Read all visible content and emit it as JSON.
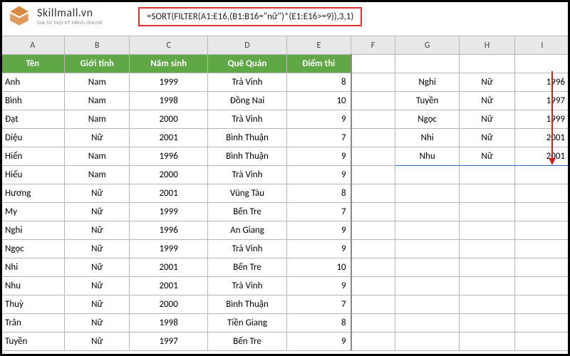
{
  "logo": {
    "main": "Skillmall.vn",
    "sub": "GIA SƯ MỌI KỸ NĂNG ONLINE"
  },
  "formula": "=SORT(FILTER(A1:E16,(B1:B16=\"nữ\")*(E1:E16>=9)),3,1)",
  "colHeads": [
    "A",
    "B",
    "C",
    "D",
    "E",
    "F",
    "G",
    "H",
    "I"
  ],
  "headers": {
    "ten": "Tên",
    "gioitinh": "Giới tính",
    "namsinh": "Năm sinh",
    "quequan": "Quê Quán",
    "diemthi": "Điểm thi"
  },
  "rows": [
    {
      "ten": "Anh",
      "gt": "Nam",
      "ns": "1999",
      "qq": "Trà Vinh",
      "dt": "8"
    },
    {
      "ten": "Bình",
      "gt": "Nam",
      "ns": "1998",
      "qq": "Đồng Nai",
      "dt": "10"
    },
    {
      "ten": "Đạt",
      "gt": "Nam",
      "ns": "2000",
      "qq": "Trà Vinh",
      "dt": "9"
    },
    {
      "ten": "Diệu",
      "gt": "Nữ",
      "ns": "2001",
      "qq": "Bình Thuận",
      "dt": "7"
    },
    {
      "ten": "Hiển",
      "gt": "Nam",
      "ns": "1996",
      "qq": "Bình Thuận",
      "dt": "9"
    },
    {
      "ten": "Hiếu",
      "gt": "Nam",
      "ns": "2000",
      "qq": "Trà Vinh",
      "dt": "9"
    },
    {
      "ten": "Hương",
      "gt": "Nữ",
      "ns": "2001",
      "qq": "Vũng Tàu",
      "dt": "8"
    },
    {
      "ten": "My",
      "gt": "Nữ",
      "ns": "1999",
      "qq": "Bến Tre",
      "dt": "7"
    },
    {
      "ten": "Nghi",
      "gt": "Nữ",
      "ns": "1996",
      "qq": "An Giang",
      "dt": "9"
    },
    {
      "ten": "Ngọc",
      "gt": "Nữ",
      "ns": "1999",
      "qq": "Trà Vinh",
      "dt": "9"
    },
    {
      "ten": "Nhi",
      "gt": "Nữ",
      "ns": "2001",
      "qq": "Bến Tre",
      "dt": "10"
    },
    {
      "ten": "Nhu",
      "gt": "Nữ",
      "ns": "2001",
      "qq": "Trà Vinh",
      "dt": "9"
    },
    {
      "ten": "Thuỳ",
      "gt": "Nữ",
      "ns": "2000",
      "qq": "Bình Thuận",
      "dt": "7"
    },
    {
      "ten": "Trân",
      "gt": "Nữ",
      "ns": "1998",
      "qq": "Tiền Giang",
      "dt": "8"
    },
    {
      "ten": "Tuyền",
      "gt": "Nữ",
      "ns": "1997",
      "qq": "Bến Tre",
      "dt": "9"
    }
  ],
  "result": [
    {
      "g": "Nghi",
      "h": "Nữ",
      "i": "1996"
    },
    {
      "g": "Tuyền",
      "h": "Nữ",
      "i": "1997"
    },
    {
      "g": "Ngọc",
      "h": "Nữ",
      "i": "1999"
    },
    {
      "g": "Nhi",
      "h": "Nữ",
      "i": "2001"
    },
    {
      "g": "Nhu",
      "h": "Nữ",
      "i": "2001"
    }
  ],
  "chart_data": {
    "type": "table",
    "title": "Student table with SORT+FILTER formula result",
    "source_columns": [
      "Tên",
      "Giới tính",
      "Năm sinh",
      "Quê Quán",
      "Điểm thi"
    ],
    "source_rows": [
      [
        "Anh",
        "Nam",
        1999,
        "Trà Vinh",
        8
      ],
      [
        "Bình",
        "Nam",
        1998,
        "Đồng Nai",
        10
      ],
      [
        "Đạt",
        "Nam",
        2000,
        "Trà Vinh",
        9
      ],
      [
        "Diệu",
        "Nữ",
        2001,
        "Bình Thuận",
        7
      ],
      [
        "Hiển",
        "Nam",
        1996,
        "Bình Thuận",
        9
      ],
      [
        "Hiếu",
        "Nam",
        2000,
        "Trà Vinh",
        9
      ],
      [
        "Hương",
        "Nữ",
        2001,
        "Vũng Tàu",
        8
      ],
      [
        "My",
        "Nữ",
        1999,
        "Bến Tre",
        7
      ],
      [
        "Nghi",
        "Nữ",
        1996,
        "An Giang",
        9
      ],
      [
        "Ngọc",
        "Nữ",
        1999,
        "Trà Vinh",
        9
      ],
      [
        "Nhi",
        "Nữ",
        2001,
        "Bến Tre",
        10
      ],
      [
        "Nhu",
        "Nữ",
        2001,
        "Trà Vinh",
        9
      ],
      [
        "Thuỳ",
        "Nữ",
        2000,
        "Bình Thuận",
        7
      ],
      [
        "Trân",
        "Nữ",
        1998,
        "Tiền Giang",
        8
      ],
      [
        "Tuyền",
        "Nữ",
        1997,
        "Bến Tre",
        9
      ]
    ],
    "result_rows": [
      [
        "Nghi",
        "Nữ",
        1996
      ],
      [
        "Tuyền",
        "Nữ",
        1997
      ],
      [
        "Ngọc",
        "Nữ",
        1999
      ],
      [
        "Nhi",
        "Nữ",
        2001
      ],
      [
        "Nhu",
        "Nữ",
        2001
      ]
    ]
  }
}
